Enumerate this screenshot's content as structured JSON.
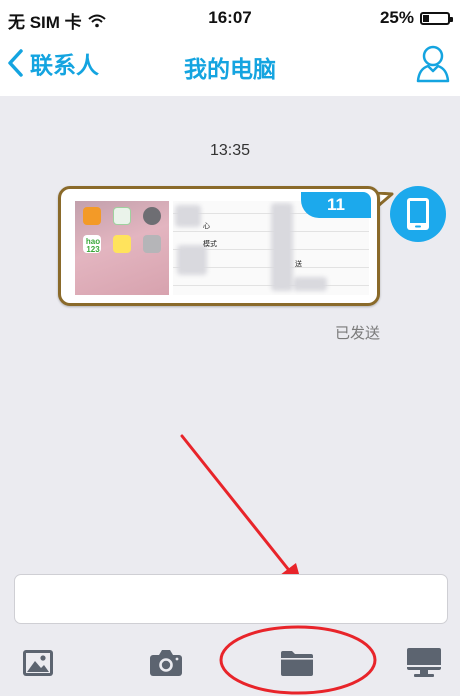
{
  "status_bar": {
    "carrier": "无 SIM 卡",
    "time": "16:07",
    "battery_percent": "25%",
    "battery_level": 0.25,
    "wifi_icon": "wifi-icon"
  },
  "nav": {
    "back_label": "联系人",
    "title": "我的电脑",
    "profile_icon": "person-outline-icon"
  },
  "chat": {
    "timestamp": "13:35",
    "message": {
      "type": "image",
      "badge": "11",
      "status": "已发送",
      "thumbnail_text": {
        "app_label": "hao 123",
        "row_text_1": "心",
        "row_text_2": "模式",
        "row_text_3": "送"
      }
    },
    "sender_icon": "phone-device-icon"
  },
  "composer": {
    "input_value": ""
  },
  "toolbar": {
    "items": [
      {
        "icon": "image-icon"
      },
      {
        "icon": "camera-icon"
      },
      {
        "icon": "folder-icon"
      },
      {
        "icon": "monitor-icon"
      }
    ]
  },
  "colors": {
    "accent": "#14a4e0",
    "badge": "#1ca9ec",
    "bubble_border": "#8a6a2a",
    "annotation_red": "#e8242a",
    "toolbar_icon": "#5c6470"
  }
}
